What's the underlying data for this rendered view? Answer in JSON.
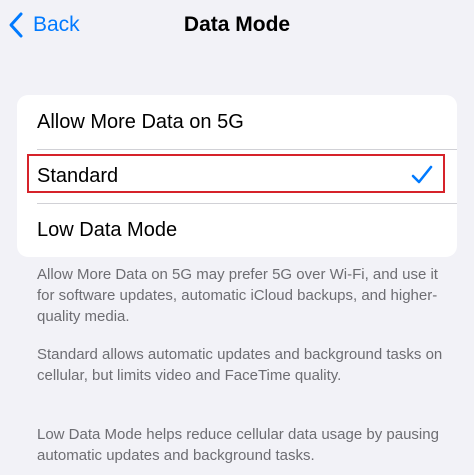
{
  "nav": {
    "back_label": "Back",
    "title": "Data Mode"
  },
  "options": [
    {
      "label": "Allow More Data on 5G",
      "selected": false
    },
    {
      "label": "Standard",
      "selected": true
    },
    {
      "label": "Low Data Mode",
      "selected": false
    }
  ],
  "footer": [
    "Allow More Data on 5G may prefer 5G over Wi-Fi, and use it for software updates, automatic iCloud backups, and higher-quality media.",
    "Standard allows automatic updates and background tasks on cellular, but limits video and FaceTime quality.",
    "Low Data Mode helps reduce cellular data usage by pausing automatic updates and background tasks."
  ],
  "colors": {
    "accent": "#007aff",
    "highlight": "#d6232a",
    "background": "#f2f2f7",
    "footer_text": "#6d6d72"
  },
  "icons": {
    "back": "chevron-left-icon",
    "selected": "checkmark-icon"
  }
}
